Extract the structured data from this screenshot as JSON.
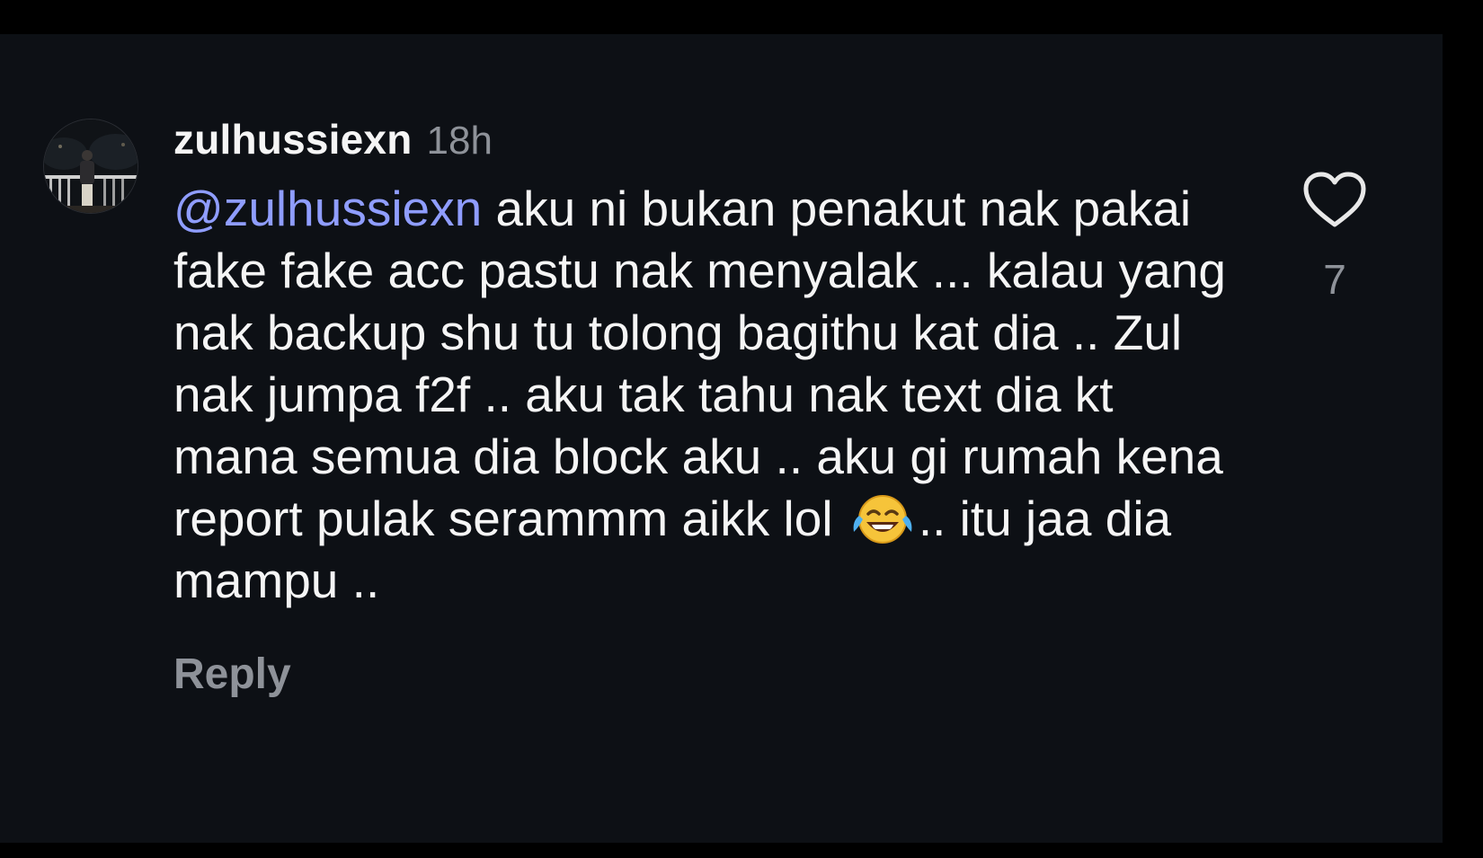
{
  "comment": {
    "username": "zulhussiexn",
    "time": "18h",
    "mention": "@zulhussiexn",
    "text_main": " aku ni bukan penakut nak pakai fake fake acc pastu nak menyalak ... kalau yang nak backup shu tu tolong bagithu kat dia .. Zul nak jumpa f2f .. aku tak tahu nak text dia kt mana semua dia block aku .. aku gi rumah kena report pulak serammm aikk lol ",
    "emoji_name": "face-with-tears-of-joy-icon",
    "text_tail": ".. itu jaa dia mampu ..",
    "reply_label": "Reply",
    "like_count": "7",
    "like_icon": "heart-outline-icon"
  },
  "colors": {
    "background": "#0d1015",
    "frame": "#000000",
    "text_primary": "#f5f5f5",
    "text_secondary": "#8e9299",
    "mention": "#8f9dff"
  }
}
